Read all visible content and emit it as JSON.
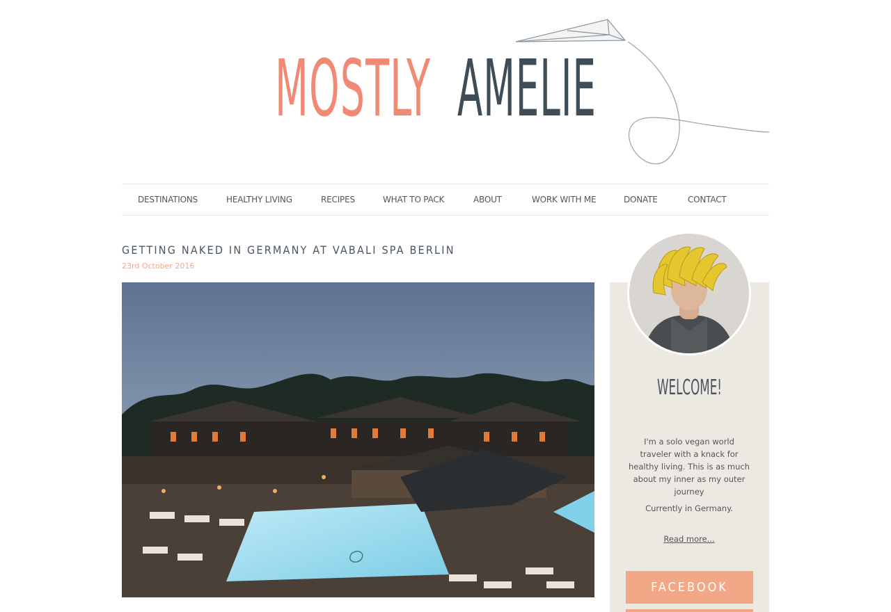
{
  "brand": {
    "word1": "MOSTLY",
    "word2": "AMELIE",
    "color1": "#f08a74",
    "color2": "#3f4d57"
  },
  "nav": {
    "items": [
      {
        "label": "DESTINATIONS"
      },
      {
        "label": "HEALTHY LIVING"
      },
      {
        "label": "RECIPES"
      },
      {
        "label": "WHAT TO PACK"
      },
      {
        "label": "ABOUT"
      },
      {
        "label": "WORK WITH ME"
      },
      {
        "label": "DONATE"
      },
      {
        "label": "CONTACT"
      }
    ]
  },
  "post": {
    "title": "GETTING NAKED IN GERMANY AT VABALI SPA BERLIN",
    "date": "23rd October 2016"
  },
  "sidebar": {
    "welcome": "WELCOME!",
    "intro": "I'm a solo vegan world traveler with a knack for healthy living. This is as much about my inner as my outer journey",
    "location": "Currently in Germany.",
    "read_more": "Read more...",
    "facebook": "FACEBOOK"
  },
  "colors": {
    "accent": "#f2a886",
    "sidebar_bg": "#ece9e3",
    "title": "#4a5560"
  }
}
